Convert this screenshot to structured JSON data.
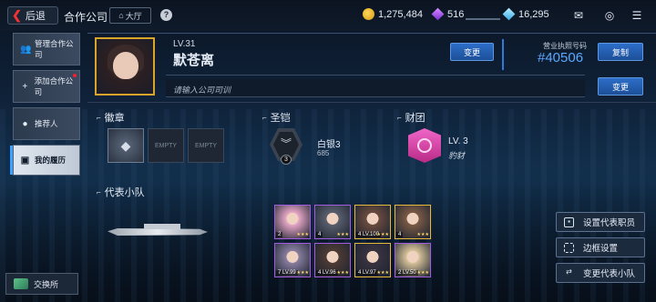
{
  "header": {
    "back_label": "后退",
    "title": "合作公司",
    "hall_label": "大厅",
    "help": "?",
    "coins": "1,275,484",
    "gems": "516",
    "diamonds": "16,295"
  },
  "sidebar": {
    "items": [
      {
        "label": "管理合作公司",
        "icon": "people-gear-icon"
      },
      {
        "label": "添加合作公司",
        "icon": "person-add-icon",
        "badge": true
      },
      {
        "label": "推荐人",
        "icon": "person-icon"
      },
      {
        "label": "我的履历",
        "icon": "id-card-icon",
        "active": true
      }
    ],
    "exchange_label": "交换所"
  },
  "profile": {
    "level": "LV.31",
    "name": "默苍离",
    "change_label": "变更",
    "license_label": "营业执照号码",
    "license_number": "#40506",
    "copy_label": "复制",
    "motto_placeholder": "请输入公司司训",
    "motto_change_label": "变更"
  },
  "sections": {
    "badge_title": "徽章",
    "badge_empty": "EMPTY",
    "armor_title": "圣铠",
    "armor_rank": "白银3",
    "armor_points": "685",
    "armor_num": "3",
    "guild_title": "财团",
    "guild_level": "LV. 3",
    "guild_name": "豹豺",
    "team_title": "代表小队"
  },
  "team": [
    {
      "lv": "2",
      "color": "#e8a8c8"
    },
    {
      "lv": "4",
      "color": "#5a5f6e"
    },
    {
      "lv": "4 LV.100",
      "color": "#6a4b3e"
    },
    {
      "lv": "4",
      "color": "#7a5a45"
    },
    {
      "lv": "7 LV.99",
      "color": "#8a7ea0"
    },
    {
      "lv": "4 LV.96",
      "color": "#4d3b35"
    },
    {
      "lv": "4 LV.97",
      "color": "#3a3340"
    },
    {
      "lv": "2 LV.50",
      "color": "#d9c49a"
    }
  ],
  "actions": {
    "set_rep": "设置代表职员",
    "frame": "边框设置",
    "change_team": "变更代表小队"
  }
}
